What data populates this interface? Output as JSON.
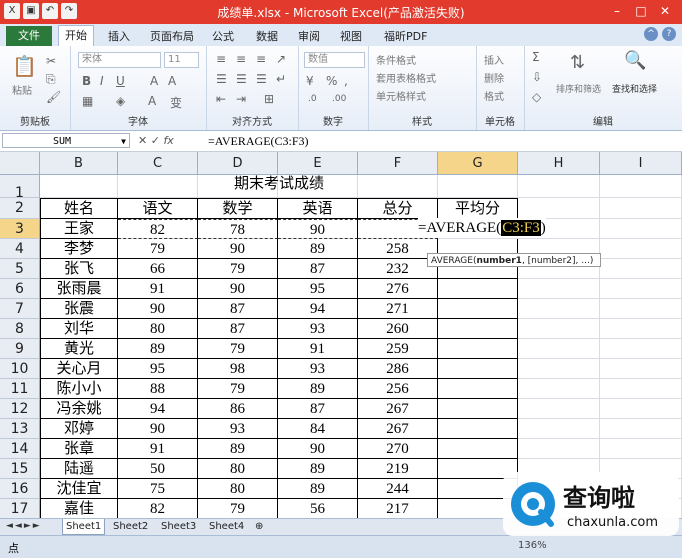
{
  "app": {
    "title": "成绩单.xlsx - Microsoft Excel(产品激活失败)",
    "tabs": [
      "文件",
      "开始",
      "插入",
      "页面布局",
      "公式",
      "数据",
      "审阅",
      "视图",
      "福昕PDF"
    ],
    "active_tab": "开始"
  },
  "ribbon": {
    "groups": [
      "剪贴板",
      "字体",
      "对齐方式",
      "数字",
      "样式",
      "单元格",
      "编辑"
    ],
    "paste_label": "粘贴",
    "font_name": "宋体",
    "font_size": "11",
    "number_format": "数值",
    "styles": [
      "条件格式",
      "套用表格格式",
      "单元格样式"
    ],
    "cells": [
      "插入",
      "删除",
      "格式"
    ],
    "sort_label": "排序和筛选",
    "find_label": "查找和选择"
  },
  "formula_bar": {
    "name_box": "SUM",
    "fx_label": "fx",
    "formula": "=AVERAGE(C3:F3)"
  },
  "columns": [
    "B",
    "C",
    "D",
    "E",
    "F",
    "G",
    "H",
    "I"
  ],
  "rows": [
    "1",
    "2",
    "3",
    "4",
    "5",
    "6",
    "7",
    "8",
    "9",
    "10",
    "11",
    "12",
    "13",
    "14",
    "15",
    "16",
    "17"
  ],
  "sheet_title": "期末考试成绩",
  "headers": [
    "姓名",
    "语文",
    "数学",
    "英语",
    "总分",
    "平均分"
  ],
  "table": [
    [
      "王家",
      "82",
      "78",
      "90",
      "",
      "=AVERAGE(C3:F3)"
    ],
    [
      "李梦",
      "79",
      "90",
      "89",
      "258",
      ""
    ],
    [
      "张飞",
      "66",
      "79",
      "87",
      "232",
      ""
    ],
    [
      "张雨晨",
      "91",
      "90",
      "95",
      "276",
      ""
    ],
    [
      "张震",
      "90",
      "87",
      "94",
      "271",
      ""
    ],
    [
      "刘华",
      "80",
      "87",
      "93",
      "260",
      ""
    ],
    [
      "黄光",
      "89",
      "79",
      "91",
      "259",
      ""
    ],
    [
      "关心月",
      "95",
      "98",
      "93",
      "286",
      ""
    ],
    [
      "陈小小",
      "88",
      "79",
      "89",
      "256",
      ""
    ],
    [
      "冯余姚",
      "94",
      "86",
      "87",
      "267",
      ""
    ],
    [
      "邓婷",
      "90",
      "93",
      "84",
      "267",
      ""
    ],
    [
      "张章",
      "91",
      "89",
      "90",
      "270",
      ""
    ],
    [
      "陆遥",
      "50",
      "80",
      "89",
      "219",
      ""
    ],
    [
      "沈佳宜",
      "75",
      "80",
      "89",
      "244",
      ""
    ],
    [
      "嘉佳",
      "82",
      "79",
      "56",
      "217",
      ""
    ]
  ],
  "formula_edit": {
    "prefix": "=AVERAGE(",
    "ref": "C3:F3",
    "suffix": ")"
  },
  "tooltip": {
    "fn": "AVERAGE(",
    "arg1": "number1",
    "rest": ", [number2], ...)"
  },
  "sheets": [
    "Sheet1",
    "Sheet2",
    "Sheet3",
    "Sheet4"
  ],
  "active_sheet": "Sheet1",
  "status": {
    "mode": "点",
    "zoom": "136%"
  },
  "watermark": {
    "brand": "查询啦",
    "url": "chaxunla.com"
  },
  "colors": {
    "title_bar": "#e23b2e",
    "file_tab": "#2b7a3b",
    "selected_header": "#f5d58a",
    "ref_highlight": "#000000",
    "ref_text": "#f0d050"
  }
}
